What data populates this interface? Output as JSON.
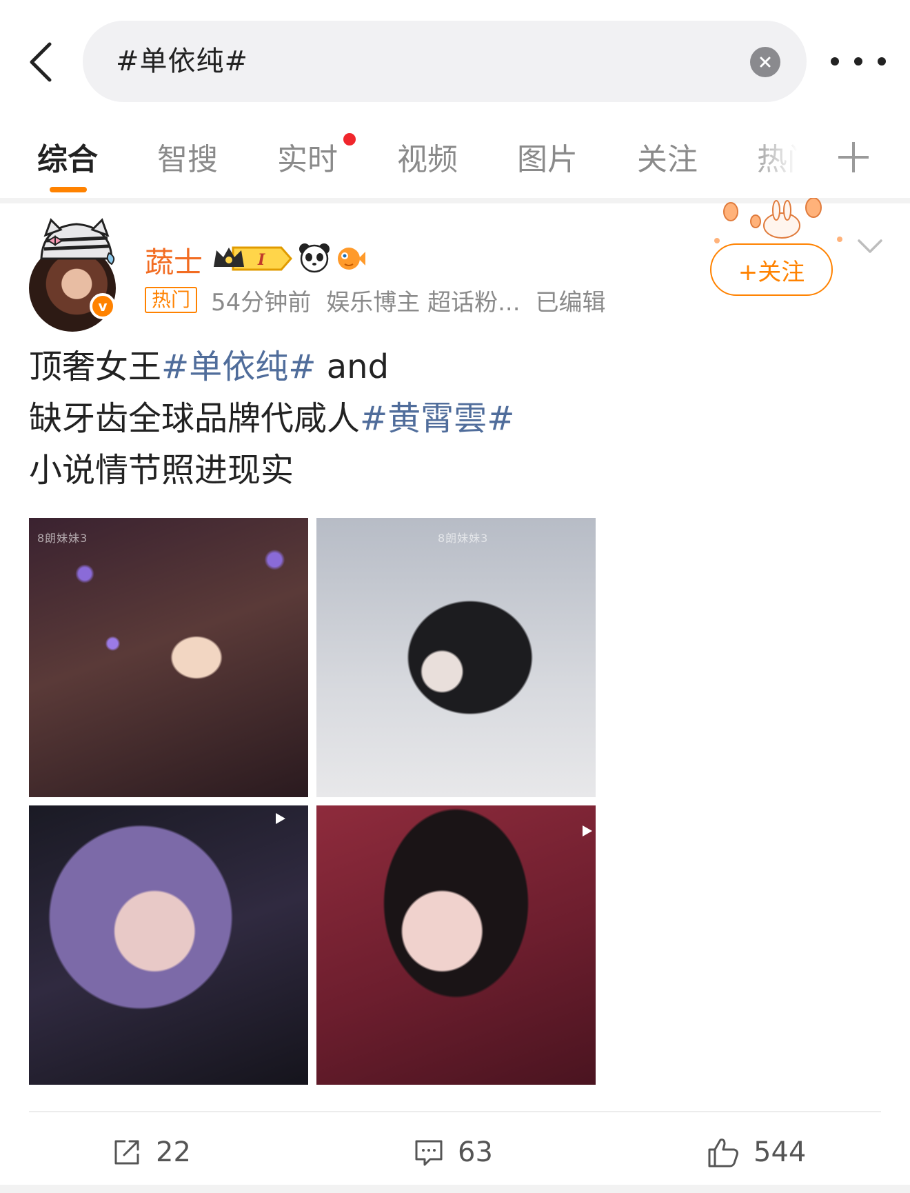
{
  "search": {
    "query": "#单依纯#"
  },
  "tabs": [
    {
      "label": "综合"
    },
    {
      "label": "智搜"
    },
    {
      "label": "实时"
    },
    {
      "label": "视频"
    },
    {
      "label": "图片"
    },
    {
      "label": "关注"
    },
    {
      "label": "热门"
    }
  ],
  "post": {
    "username": "蔬士",
    "vip_level": "I",
    "hot_tag": "热门",
    "time": "54分钟前",
    "source": "娱乐博主 超话粉...",
    "edited": "已编辑",
    "follow_label": "+关注",
    "verified_mark": "v",
    "text": {
      "line1_prefix": "顶奢女王",
      "line1_tag": "#单依纯#",
      "line1_suffix": " and",
      "line2_prefix": "缺牙齿全球品牌代咸人",
      "line2_tag": "#黄霄雲#",
      "line3": "小说情节照进现实"
    },
    "images": [
      {
        "watermark": "8朗妹妹3",
        "has_play": false
      },
      {
        "watermark": "8朗妹妹3",
        "has_play": false
      },
      {
        "watermark": "",
        "has_play": true
      },
      {
        "watermark": "",
        "has_play": true
      }
    ],
    "actions": {
      "reposts": "22",
      "comments": "63",
      "likes": "544"
    }
  },
  "colors": {
    "accent": "#ff8200",
    "username": "#f26c22",
    "hashtag": "#506d9b",
    "red_dot": "#f0262c"
  }
}
